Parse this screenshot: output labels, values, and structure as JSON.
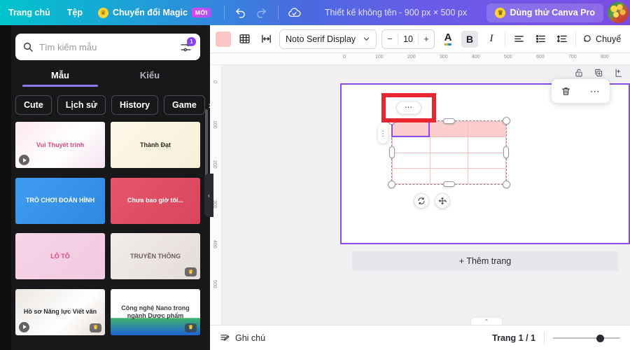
{
  "topbar": {
    "home": "Trang chủ",
    "file": "Tệp",
    "magic": "Chuyển đổi Magic",
    "magic_badge": "Mới",
    "undo_icon": "undo-icon",
    "redo_icon": "redo-icon",
    "cloud_icon": "cloud-sync-icon",
    "doc_title": "Thiết kế không tên - 900 px × 500 px",
    "pro_label": "Dùng thử Canva Pro",
    "crown_glyph": "♛",
    "avatar_name": "user-avatar"
  },
  "sidebar": {
    "search": {
      "placeholder": "Tìm kiếm mẫu",
      "value": "",
      "filter_badge": "1"
    },
    "tabs": [
      {
        "label": "Mẫu",
        "active": true
      },
      {
        "label": "Kiểu",
        "active": false
      }
    ],
    "chips": [
      "Cute",
      "Lịch sử",
      "History",
      "Game"
    ],
    "chip_next": "›",
    "templates": [
      {
        "title": "Vui Thuyết trình",
        "color": "#ffffff",
        "text_color": "#e0457b",
        "bg": "linear-gradient(135deg,#fde9ee 0%,#ffffff 55%,#f6e3f0 100%)",
        "play": true,
        "crown": false
      },
      {
        "title": "Thành Đạt",
        "color": "#fdf7e7",
        "text_color": "#2f2a22",
        "bg": "linear-gradient(135deg,#fdf8e9 0%,#f7efd9 100%)",
        "play": false,
        "crown": false
      },
      {
        "title": "TRÒ CHƠI ĐOÁN HÌNH",
        "color": "#3e9bec",
        "text_color": "#ffffff",
        "bg": "linear-gradient(135deg,#3f9ced 0%,#2f8ae0 100%)",
        "play": false,
        "crown": false
      },
      {
        "title": "Chưa bao giờ tôi...",
        "color": "#e2566a",
        "text_color": "#ffffff",
        "bg": "linear-gradient(135deg,#e4566b 0%,#d9455c 100%)",
        "play": false,
        "crown": false
      },
      {
        "title": "LÔ TÔ",
        "color": "#f6d3e6",
        "text_color": "#e0457b",
        "bg": "linear-gradient(135deg,#f7d4e7 0%,#f2c9e0 100%)",
        "play": false,
        "crown": false
      },
      {
        "title": "TRUYỀN THÔNG",
        "color": "#efe9e6",
        "text_color": "#6b6159",
        "bg": "linear-gradient(135deg,#f2ecea 0%,#e4dcd8 100%)",
        "play": false,
        "crown": true
      },
      {
        "title": "Hồ sơ Năng lực Viết văn",
        "color": "#ffffff",
        "text_color": "#2b2b31",
        "bg": "linear-gradient(135deg,#ece7e2 0%,#ffffff 60%,#e6ddd6 100%)",
        "play": true,
        "crown": true
      },
      {
        "title": "Công nghệ Nano trong ngành Dược phẩm",
        "color": "#ffffff",
        "text_color": "#3c3c42",
        "bg": "linear-gradient(180deg,#ffffff 0%,#ffffff 62%,#3fb26a 63%,#1f62d8 100%)",
        "play": false,
        "crown": true
      }
    ],
    "collapse_glyph": "‹"
  },
  "toolbar": {
    "fill_color": "#f9c6c6",
    "grid_icon": "table-grid-icon",
    "width_icon": "cell-width-icon",
    "font_name": "Noto Serif Display",
    "font_caret": "⌄",
    "size_minus": "−",
    "size_value": "10",
    "size_plus": "+",
    "text_color_label": "A",
    "bold_label": "B",
    "italic_label": "I",
    "align_icon": "align-left-icon",
    "list_icon": "bullet-list-icon",
    "spacing_icon": "line-spacing-icon",
    "effects_label": "Chuyể"
  },
  "rulers": {
    "horizontal": [
      "0",
      "100",
      "200",
      "300",
      "400",
      "500",
      "600",
      "700",
      "800"
    ],
    "vertical": [
      "0",
      "100",
      "200",
      "300",
      "400",
      "500"
    ]
  },
  "canvas": {
    "page_icons": {
      "lock": "lock-icon",
      "duplicate": "duplicate-icon",
      "add": "add-page-icon"
    },
    "object_toolbar": {
      "delete": "trash-icon",
      "more": "⋯"
    },
    "annotation": {
      "pill_label": "⋯",
      "border_color": "#e8262e"
    },
    "side_menu": "⋮",
    "table": {
      "rows": 4,
      "cols": 3,
      "header_fill": "#fbcdcd",
      "selected_cell": "r0c0",
      "selection_color": "#8b4df0"
    },
    "rotate_icon": "rotate-icon",
    "move_icon": "move-icon",
    "add_page_label": "+ Thêm trang"
  },
  "bottombar": {
    "notes_icon": "notes-icon",
    "notes_label": "Ghi chú",
    "page_count": "Trang 1 / 1",
    "panel_toggle": "⌃"
  }
}
